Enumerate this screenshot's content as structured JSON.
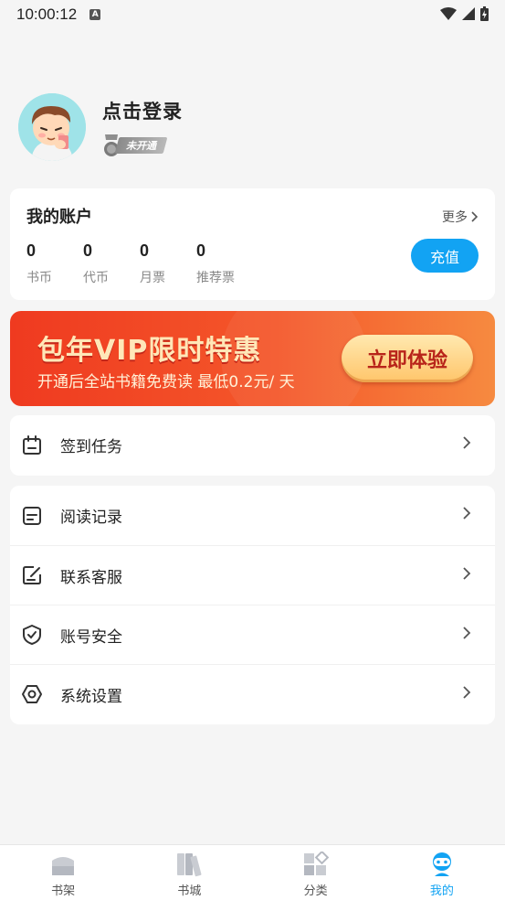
{
  "status_bar": {
    "time": "10:00:12"
  },
  "profile": {
    "login_text": "点击登录",
    "vip_status": "未开通"
  },
  "account": {
    "title": "我的账户",
    "more_label": "更多",
    "stats": [
      {
        "value": "0",
        "label": "书币"
      },
      {
        "value": "0",
        "label": "代币"
      },
      {
        "value": "0",
        "label": "月票"
      },
      {
        "value": "0",
        "label": "推荐票"
      }
    ],
    "recharge_label": "充值"
  },
  "banner": {
    "title": "包年VIP限时特惠",
    "subtitle": "开通后全站书籍免费读 最低0.2元/ 天",
    "button_label": "立即体验"
  },
  "menu": {
    "checkin": {
      "label": "签到任务",
      "icon": "calendar-icon"
    },
    "items": [
      {
        "label": "阅读记录",
        "icon": "document-icon"
      },
      {
        "label": "联系客服",
        "icon": "edit-icon"
      },
      {
        "label": "账号安全",
        "icon": "shield-check-icon"
      },
      {
        "label": "系统设置",
        "icon": "hexagon-settings-icon"
      }
    ]
  },
  "bottom_nav": {
    "items": [
      {
        "label": "书架",
        "icon": "bookshelf-icon"
      },
      {
        "label": "书城",
        "icon": "bookstore-icon"
      },
      {
        "label": "分类",
        "icon": "category-icon"
      },
      {
        "label": "我的",
        "icon": "profile-icon"
      }
    ],
    "active_index": 3
  },
  "colors": {
    "accent": "#12a3f3",
    "banner_start": "#ef3a20",
    "banner_end": "#f68a40",
    "background": "#f5f5f5"
  }
}
